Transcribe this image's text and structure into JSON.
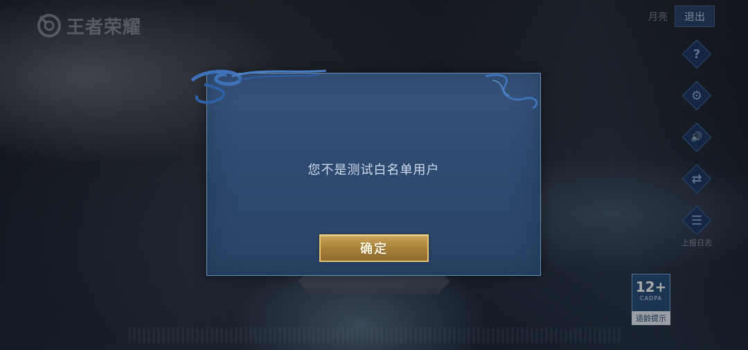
{
  "game": {
    "logo_text": "王者荣耀"
  },
  "header": {
    "moon_label": "月亮",
    "exit_label": "退出"
  },
  "side_menu": {
    "items": [
      {
        "icon": "help-icon",
        "glyph": "?"
      },
      {
        "icon": "repair-icon",
        "glyph": "⚙"
      },
      {
        "icon": "sound-icon",
        "glyph": "🔊"
      },
      {
        "icon": "switch-account-icon",
        "glyph": "⇄"
      },
      {
        "icon": "log-icon",
        "glyph": "☰",
        "label": "上报日志"
      }
    ]
  },
  "rating": {
    "age": "12+",
    "org": "CADPA",
    "tip": "适龄提示"
  },
  "dialog": {
    "message": "您不是测试白名单用户",
    "confirm_label": "确定"
  },
  "colors": {
    "dialog_bg": "#2e4a70",
    "dialog_border": "#6d8fb8",
    "button_gold": "#c9a35a",
    "message_text": "#cfdcee"
  }
}
